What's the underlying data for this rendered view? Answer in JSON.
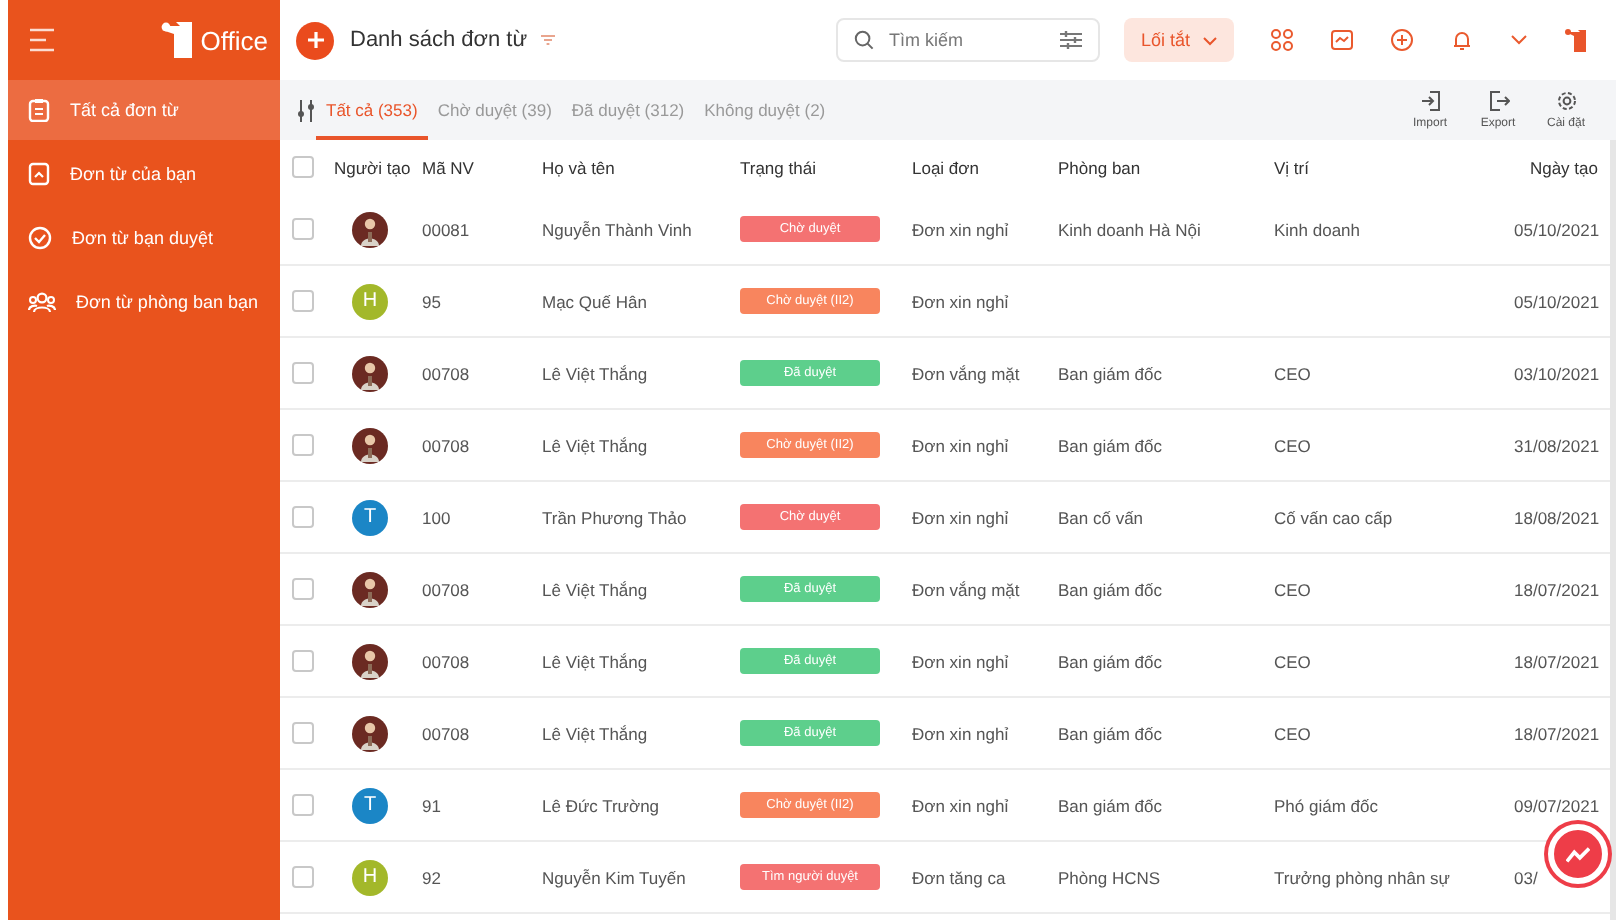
{
  "sidebar": {
    "brand": "Office",
    "items": [
      {
        "label": "Tất cả đơn từ",
        "selected": true
      },
      {
        "label": "Đơn từ của bạn",
        "selected": false
      },
      {
        "label": "Đơn từ bạn duyệt",
        "selected": false
      },
      {
        "label": "Đơn từ phòng ban bạn",
        "selected": false
      }
    ]
  },
  "header": {
    "title": "Danh sách đơn từ",
    "search": {
      "placeholder": "Tìm kiếm"
    },
    "shortcut": "Lối tắt"
  },
  "tabs": [
    {
      "label": "Tất cả (353)",
      "selected": true
    },
    {
      "label": "Chờ duyệt (39)",
      "selected": false
    },
    {
      "label": "Đã duyệt (312)",
      "selected": false
    },
    {
      "label": "Không duyệt (2)",
      "selected": false
    }
  ],
  "actions": [
    {
      "label": "Import"
    },
    {
      "label": "Export"
    },
    {
      "label": "Cài đặt"
    }
  ],
  "table": {
    "select_all": {
      "checked": false
    },
    "columns": [
      "Người tạo",
      "Mã NV",
      "Họ và tên",
      "Trạng thái",
      "Loại đơn",
      "Phòng ban",
      "Vị trí",
      "Ngày tạo"
    ],
    "rows": [
      {
        "checked": false,
        "code": "00081",
        "name": "Nguyễn Thành Vinh",
        "status": {
          "text": "Chờ duyệt",
          "color": "#f47272"
        },
        "type": "Đơn xin nghỉ",
        "department": "Kinh doanh Hà Nội",
        "position": "Kinh doanh",
        "date": "05/10/2021"
      },
      {
        "checked": false,
        "avatar": {
          "kind": "letter",
          "letter": "H",
          "color": "#a3b82a"
        },
        "code": "95",
        "name": "Mạc Quế Hân",
        "status": {
          "text": "Chờ duyệt (II2)",
          "color": "#f8855e"
        },
        "type": "Đơn xin nghỉ",
        "date": "05/10/2021"
      },
      {
        "checked": false,
        "code": "00708",
        "name": "Lê Việt Thắng",
        "status": {
          "text": "Đã duyệt",
          "color": "#5dcf8c"
        },
        "type": "Đơn vắng mặt",
        "department": "Ban giám đốc",
        "position": "CEO",
        "date": "03/10/2021"
      },
      {
        "checked": false,
        "code": "00708",
        "name": "Lê Việt Thắng",
        "status": {
          "text": "Chờ duyệt (II2)",
          "color": "#f8855e"
        },
        "type": "Đơn xin nghỉ",
        "department": "Ban giám đốc",
        "position": "CEO",
        "date": "31/08/2021"
      },
      {
        "checked": false,
        "avatar": {
          "kind": "letter",
          "letter": "T",
          "color": "#1b86c6"
        },
        "code": "100",
        "name": "Trần Phương Thảo",
        "status": {
          "text": "Chờ duyệt",
          "color": "#f47272"
        },
        "type": "Đơn xin nghỉ",
        "department": "Ban cố vấn",
        "position": "Cố vấn cao cấp",
        "date": "18/08/2021"
      },
      {
        "checked": false,
        "code": "00708",
        "name": "Lê Việt Thắng",
        "status": {
          "text": "Đã duyệt",
          "color": "#5dcf8c"
        },
        "type": "Đơn vắng mặt",
        "department": "Ban giám đốc",
        "position": "CEO",
        "date": "18/07/2021"
      },
      {
        "checked": false,
        "code": "00708",
        "name": "Lê Việt Thắng",
        "status": {
          "text": "Đã duyệt",
          "color": "#5dcf8c"
        },
        "type": "Đơn xin nghỉ",
        "department": "Ban giám đốc",
        "position": "CEO",
        "date": "18/07/2021"
      },
      {
        "checked": false,
        "code": "00708",
        "name": "Lê Việt Thắng",
        "status": {
          "text": "Đã duyệt",
          "color": "#5dcf8c"
        },
        "type": "Đơn xin nghỉ",
        "department": "Ban giám đốc",
        "position": "CEO",
        "date": "18/07/2021"
      },
      {
        "checked": false,
        "avatar": {
          "kind": "letter",
          "letter": "T",
          "color": "#1b86c6"
        },
        "code": "91",
        "name": "Lê Đức Trường",
        "status": {
          "text": "Chờ duyệt (II2)",
          "color": "#f8855e"
        },
        "type": "Đơn xin nghỉ",
        "department": "Ban giám đốc",
        "position": "Phó giám đốc",
        "date": "09/07/2021"
      },
      {
        "checked": false,
        "avatar": {
          "kind": "letter",
          "letter": "H",
          "color": "#a3b82a"
        },
        "code": "92",
        "name": "Nguyễn Kim Tuyến",
        "status": {
          "text": "Tìm người duyệt",
          "color": "#f47272"
        },
        "type": "Đơn tăng ca",
        "department": "Phòng HCNS",
        "position": "Trưởng phòng nhân sự",
        "date": "03/"
      }
    ]
  }
}
